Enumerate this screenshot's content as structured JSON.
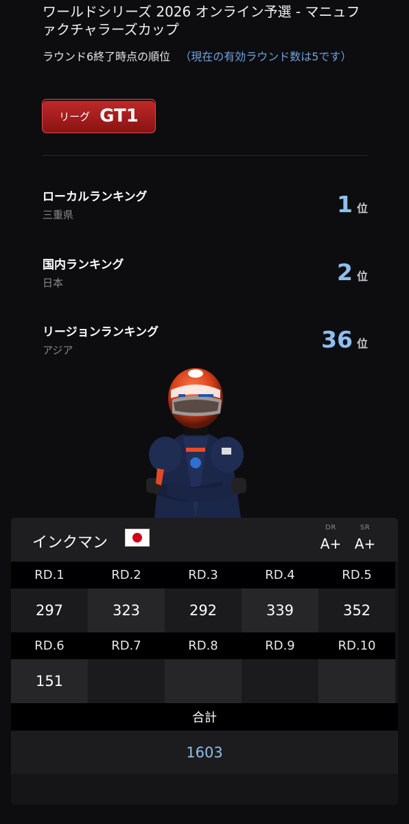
{
  "header": {
    "title": "ワールドシリーズ 2026 オンライン予選 - マニュファクチャラーズカップ",
    "subtitle": "ラウンド6終了時点の順位",
    "note": "（現在の有効ラウンド数は5です）"
  },
  "league": {
    "label": "リーグ",
    "value": "GT1",
    "color": "#b71c1c"
  },
  "rankings": [
    {
      "name": "ローカルランキング",
      "region": "三重県",
      "rank": "1",
      "unit": "位"
    },
    {
      "name": "国内ランキング",
      "region": "日本",
      "rank": "2",
      "unit": "位"
    },
    {
      "name": "リージョンランキング",
      "region": "アジア",
      "rank": "36",
      "unit": "位"
    }
  ],
  "player": {
    "name": "インクマン",
    "flag_icon": "japan-flag-icon",
    "dr_label": "DR",
    "dr_value": "A+",
    "sr_label": "SR",
    "sr_value": "A+"
  },
  "rounds": [
    {
      "label": "RD.1",
      "score": "297"
    },
    {
      "label": "RD.2",
      "score": "323"
    },
    {
      "label": "RD.3",
      "score": "292"
    },
    {
      "label": "RD.4",
      "score": "339"
    },
    {
      "label": "RD.5",
      "score": "352"
    },
    {
      "label": "RD.6",
      "score": "151"
    },
    {
      "label": "RD.7",
      "score": ""
    },
    {
      "label": "RD.8",
      "score": ""
    },
    {
      "label": "RD.9",
      "score": ""
    },
    {
      "label": "RD.10",
      "score": ""
    }
  ],
  "total": {
    "label": "合計",
    "value": "1603"
  },
  "colors": {
    "accent_blue": "#8dbff0",
    "league_red": "#b71c1c",
    "background": "#0d0d0f"
  }
}
